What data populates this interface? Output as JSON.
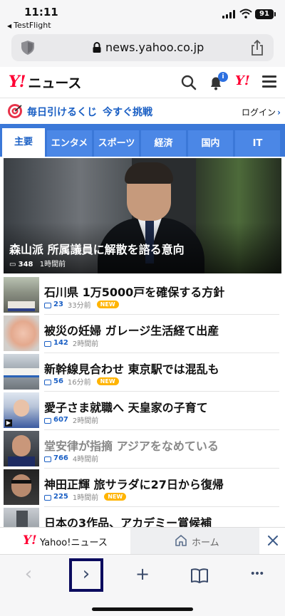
{
  "status_bar": {
    "time": "11:11",
    "back_app": "TestFlight",
    "battery": "91"
  },
  "browser": {
    "url": "news.yahoo.co.jp"
  },
  "header": {
    "logo_y": "Y!",
    "logo_label": "ニュース",
    "notification_count": "i",
    "yahoo_mark": "Y!"
  },
  "lottery": {
    "text1": "毎日引けるくじ",
    "text2": "今すぐ挑戦",
    "login": "ログイン"
  },
  "tabs": [
    {
      "label": "主要",
      "active": true
    },
    {
      "label": "エンタメ"
    },
    {
      "label": "スポーツ"
    },
    {
      "label": "経済"
    },
    {
      "label": "国内"
    },
    {
      "label": "IT"
    }
  ],
  "hero": {
    "title": "森山派 所属議員に解散を諮る意向",
    "comments": "348",
    "time": "1時間前"
  },
  "news": [
    {
      "title": "石川県 1万5000戸を確保する方針",
      "comments": "23",
      "time": "33分前",
      "new": "NEW"
    },
    {
      "title": "被災の妊婦 ガレージ生活経て出産",
      "comments": "142",
      "time": "2時間前"
    },
    {
      "title": "新幹線見合わせ 東京駅では混乱も",
      "comments": "56",
      "time": "16分前",
      "new": "NEW"
    },
    {
      "title": "愛子さま就職へ 天皇家の子育て",
      "comments": "607",
      "time": "2時間前"
    },
    {
      "title": "堂安律が指摘 アジアをなめている",
      "comments": "766",
      "time": "4時間前"
    },
    {
      "title": "神田正輝 旅サラダに27日から復帰",
      "comments": "225",
      "time": "1時間前",
      "new": "NEW"
    },
    {
      "title": "日本の3作品、アカデミー賞候補"
    }
  ],
  "bottom_tabs": {
    "tab1_logo": "Y!",
    "tab1": "Yahoo!ニュース",
    "tab2": "ホーム"
  },
  "toolbar": {
    "back": "‹",
    "forward": "›",
    "add": "+",
    "more": "•••"
  },
  "colors": {
    "accent": "#3b78d8",
    "link": "#1a5fc4",
    "brand_red": "#ff0033",
    "new_badge": "#ffb400"
  }
}
